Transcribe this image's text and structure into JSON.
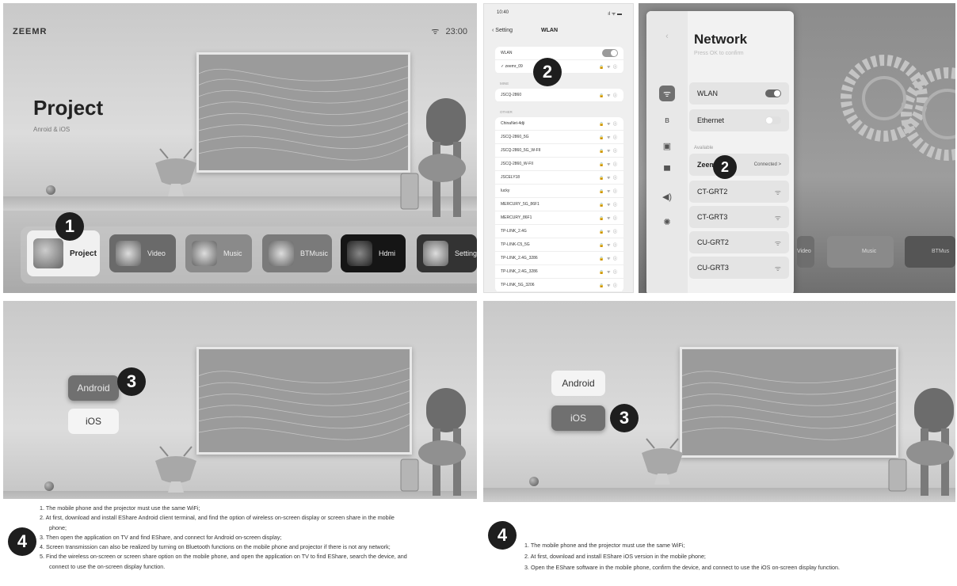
{
  "panel_a": {
    "logo": "ZEEMR",
    "clock": "23:00",
    "title": "Project",
    "subtitle": "Anroid & iOS",
    "dock": [
      {
        "label": "Project",
        "icon": "projector-icon"
      },
      {
        "label": "Video",
        "icon": "play-icon"
      },
      {
        "label": "Music",
        "icon": "music-note-icon"
      },
      {
        "label": "BTMusic",
        "icon": "speaker-icon"
      },
      {
        "label": "Hdmi",
        "icon": "hdmi-icon"
      },
      {
        "label": "Setting",
        "icon": "gear-icon"
      }
    ],
    "badge": "1"
  },
  "panel_b": {
    "time": "10:40",
    "signal": "ıl ᯤ ▬",
    "back_label": "Setting",
    "title": "WLAN",
    "wlan_label": "WLAN",
    "connected": "zeemr_09",
    "badge": "2",
    "section_mine": "MINE",
    "mine": [
      "JSCQ-2860"
    ],
    "section_other": "OTHER",
    "networks": [
      "ChinaNet-4dji",
      "JSCQ-2860_5G",
      "JSCQ-2860_5G_W-FII",
      "JSCQ-2860_W-FII",
      "JSCELY18",
      "lucky",
      "MERCURY_5G_86F1",
      "MERCURY_86F1",
      "TP-LINK_2.4G",
      "TP-LINK-C5_5G",
      "TP-LINK_2.4G_3286",
      "TP-LINK_2.4G_3286",
      "TP-LINK_5G_3206"
    ],
    "row_icons": "🔒 ᯤ ⓘ"
  },
  "panel_c": {
    "title": "Network",
    "hint": "Press OK to confirm",
    "wlan_label": "WLAN",
    "ethernet_label": "Ethernet",
    "available_label": "Available",
    "connected_network": "Zeemr",
    "connected_status": "Connected >",
    "networks": [
      "CT-GRT2",
      "CT-GRT3",
      "CU-GRT2",
      "CU-GRT3"
    ],
    "badge": "2",
    "dock_ghost": [
      "Video",
      "Music",
      "BTMus"
    ]
  },
  "panel_d": {
    "android": "Android",
    "ios": "iOS",
    "badge3": "3",
    "badge4": "4",
    "steps": [
      "1.  The mobile phone and the projector must use the same WiFi;",
      "2.  At first, download and install EShare Android client terminal, and find the option of wireless on-screen display or screen share in the mobile",
      "phone;",
      "3.  Then open the application on TV and find EShare, and connect for Android on-screen display;",
      "4.  Screen transmission can also be realized by turning on Bluetooth functions on the mobile phone and projector if there is not any network;",
      "5.  Find the wireless on-screen or screen share option on the mobile phone, and open the application on TV to find EShare, search the device, and",
      "connect to use the on-screen display function."
    ]
  },
  "panel_e": {
    "android": "Android",
    "ios": "iOS",
    "badge3": "3",
    "badge4": "4",
    "steps": [
      "1.  The mobile phone and the projector must use the same WiFi;",
      "2.  At first, download and install EShare iOS version in the mobile phone;",
      "3.  Open the EShare software in the mobile phone, confirm the device, and connect to use the iOS on-screen display function."
    ]
  },
  "colors": {
    "badge": "#1e1e1e",
    "selected_button": "#707070",
    "scene_gray": "#c9c9c9"
  }
}
